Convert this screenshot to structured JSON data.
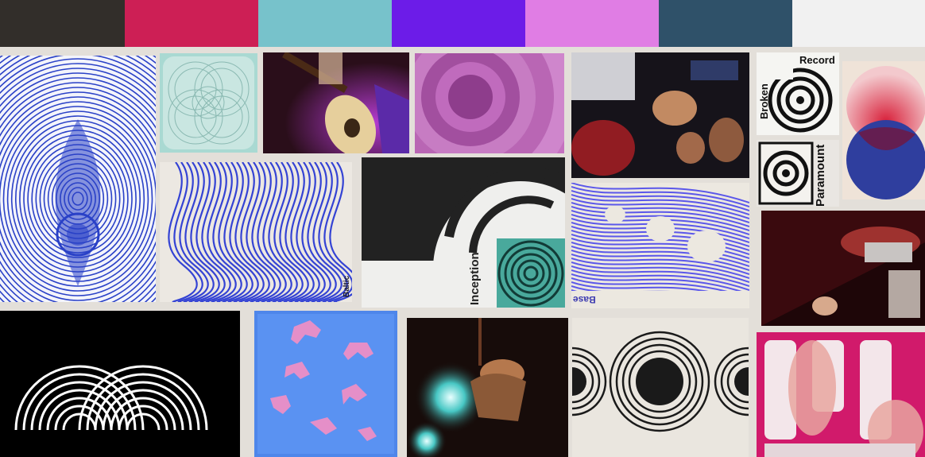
{
  "palette": {
    "colors": [
      "#322e2a",
      "#cd1f55",
      "#77c2cb",
      "#6c1ce8",
      "#e07de4",
      "#2f5169",
      "#f1f1f1"
    ]
  },
  "board": {
    "background": "#e3dfd9",
    "texts": {
      "baltic_sea": "Baltic Sea",
      "inception": "Inception",
      "broken": "Broken",
      "record": "Record",
      "paramount": "Paramount",
      "base": "Base"
    }
  }
}
